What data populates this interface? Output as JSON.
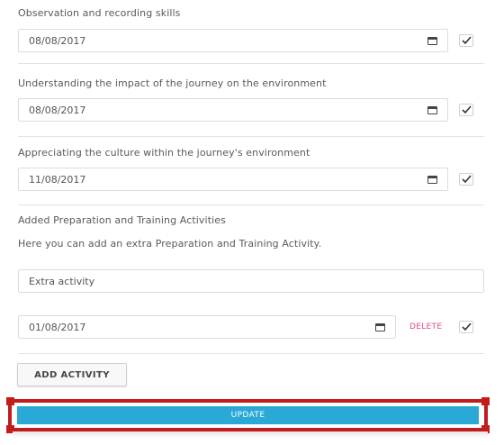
{
  "sections": [
    {
      "label": "Observation and recording skills",
      "date": "08/08/2017",
      "checked": true
    },
    {
      "label": "Understanding the impact of the journey on the environment",
      "date": "08/08/2017",
      "checked": true
    },
    {
      "label": "Appreciating the culture within the journey's environment",
      "date": "11/08/2017",
      "checked": true
    }
  ],
  "added": {
    "heading": "Added Preparation and Training Activities",
    "help": "Here you can add an extra Preparation and Training Activity.",
    "activity_name": "Extra activity",
    "activity_date": "01/08/2017",
    "delete_label": "DELETE",
    "checked": true
  },
  "buttons": {
    "add_activity": "ADD ACTIVITY",
    "update": "UPDATE"
  },
  "icons": {
    "calendar": "calendar-icon",
    "check": "checkmark-icon"
  },
  "colors": {
    "update_bg": "#2aa8d6",
    "highlight_border": "#c21d1d",
    "delete": "#e2488a"
  }
}
